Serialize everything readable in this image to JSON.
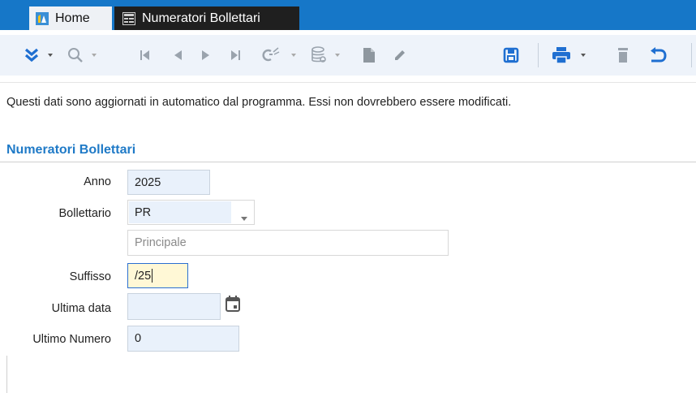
{
  "tabs": [
    {
      "label": "Home",
      "active": false
    },
    {
      "label": "Numeratori Bollettari",
      "active": true
    }
  ],
  "colors": {
    "titlebar": "#1677c8",
    "accent_blue": "#1f7ac7",
    "field_bg": "#e9f1fb",
    "focus_bg": "#fff8d6"
  },
  "toolbar": {
    "icons": [
      "expand-icon",
      "search-icon",
      "first-record-icon",
      "prev-record-icon",
      "next-record-icon",
      "last-record-icon",
      "filter-icon",
      "database-icon",
      "new-document-icon",
      "edit-icon",
      "save-icon",
      "print-icon",
      "delete-icon",
      "undo-icon"
    ]
  },
  "notice": "Questi dati sono aggiornati in automatico dal programma. Essi non dovrebbero essere modificati.",
  "section_title": "Numeratori Bollettari",
  "form": {
    "anno": {
      "label": "Anno",
      "value": "2025"
    },
    "bollettario": {
      "label": "Bollettario",
      "value": "PR",
      "description": "Principale"
    },
    "suffisso": {
      "label": "Suffisso",
      "value": "/25"
    },
    "ultima_data": {
      "label": "Ultima data",
      "value": ""
    },
    "ultimo_numero": {
      "label": "Ultimo Numero",
      "value": "0"
    }
  }
}
